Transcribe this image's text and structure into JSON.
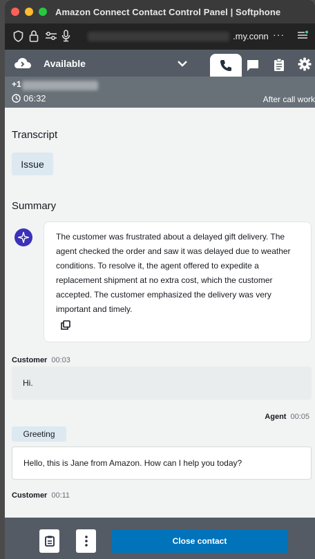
{
  "window": {
    "title": "Amazon Connect Contact Control Panel | Softphone"
  },
  "urlbar": {
    "url_visible": ".my.conn",
    "more": "···"
  },
  "status": {
    "label": "Available",
    "icon": "cloud-icon"
  },
  "call": {
    "number_prefix": "+1",
    "timer": "06:32",
    "state": "After call work"
  },
  "transcript": {
    "heading": "Transcript",
    "category": "Issue"
  },
  "summary": {
    "heading": "Summary",
    "text": "The customer was frustrated about a delayed gift delivery. The agent checked the order and saw it was delayed due to weather conditions. To resolve it, the agent offered to expedite a replacement shipment at no extra cost, which the customer accepted. The customer emphasized the delivery was very important and timely."
  },
  "messages": [
    {
      "speaker": "Customer",
      "time": "00:03",
      "text": "Hi."
    },
    {
      "speaker": "Agent",
      "time": "00:05",
      "category": "Greeting",
      "text": "Hello, this is Jane from Amazon. How can I help you today?"
    },
    {
      "speaker": "Customer",
      "time": "00:11"
    }
  ],
  "footer": {
    "close_label": "Close contact"
  },
  "colors": {
    "accent": "#0073bb",
    "status_bar": "#545b64",
    "call_bar": "#687078",
    "pill": "#dde9f1",
    "ai": "#3b32b8"
  }
}
